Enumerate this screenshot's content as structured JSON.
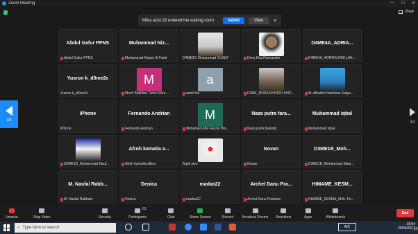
{
  "window": {
    "title": "Zoom Meeting",
    "view_label": "View"
  },
  "notification": {
    "message": "Mitra azizi 28 entered the waiting room",
    "admit": "Admit",
    "view": "View",
    "close": "✕"
  },
  "pager": {
    "left": "3/3",
    "right": "3/3"
  },
  "tiles": [
    {
      "big": "Abdul Gafur PPNS",
      "label": "Abdul Gafur PPNS"
    },
    {
      "big": "Muhammad  Niz...",
      "label": "Muhammad Nizam Al Farid"
    },
    {
      "big": "",
      "label": "D4ME2C Muhammad YUSUF"
    },
    {
      "big": "",
      "label": "Deny Eka Rismandar"
    },
    {
      "big": "D4ME4A_ADRIA...",
      "label": "D4ME4A_ADRIAN DWI LAK..."
    },
    {
      "big": "Yusron k_d3me2c",
      "label": "Yusron k_d3me2c"
    },
    {
      "big": "",
      "avatar": "M",
      "label": "Moch Bakhtiar Torico Wira ..."
    },
    {
      "big": "",
      "avatar": "a",
      "label": "amid fira"
    },
    {
      "big": "",
      "label": "D3ME_HUDA KHOIRU KHIF..."
    },
    {
      "big": "",
      "label": "M. Athallah Nandana Satya..."
    },
    {
      "big": "iPhone",
      "label": "iPhone"
    },
    {
      "big": "Fernando Andrian",
      "label": "Fernando Andrian"
    },
    {
      "big": "",
      "avatar": "M",
      "label": "Mohamad Alfa Fauzia Her..."
    },
    {
      "big": "Naza putra fara...",
      "label": "Naza putra farandy"
    },
    {
      "big": "Muhammad iqbal",
      "label": "Muhammad iqbal"
    },
    {
      "big": "",
      "label": "D3ME1B_Muhammad Nauf..."
    },
    {
      "big": "Afroh kamalia a...",
      "label": "Afroh kamalia alfina"
    },
    {
      "big": "",
      "label": "Aghil styo"
    },
    {
      "big": "Novan",
      "label": "Novan"
    },
    {
      "big": "D3ME1B_Moh...",
      "label": "D3ME1B_Mohammad Maul..."
    },
    {
      "big": "M. Naufal Rabb...",
      "label": "M. Naufal Rabbani"
    },
    {
      "big": "Denica",
      "label": "Denica"
    },
    {
      "big": "madaa22",
      "label": "madaa22"
    },
    {
      "big": "Archel Danu Pra...",
      "label": "Archel Danu Pratama"
    },
    {
      "big": "HIMAME_KESM...",
      "label": "HIMAME_KESMA_Moh. Pu..."
    }
  ],
  "toolbar": {
    "unmute": "Unmute",
    "stop_video": "Stop Video",
    "security": "Security",
    "participants": "Participants",
    "participants_count": "61",
    "chat": "Chat",
    "share": "Share Screen",
    "record": "Record",
    "breakout": "Breakout Rooms",
    "reactions": "Reactions",
    "apps": "Apps",
    "whiteboards": "Whiteboards",
    "end": "End"
  },
  "taskbar": {
    "search": "Type here to search",
    "lang": "A/C",
    "time": "19:54",
    "date": "20/05/2023",
    "badge": "14"
  },
  "colors": {
    "accent": "#0e72ed",
    "end": "#e0393e",
    "share": "#27ae60"
  }
}
